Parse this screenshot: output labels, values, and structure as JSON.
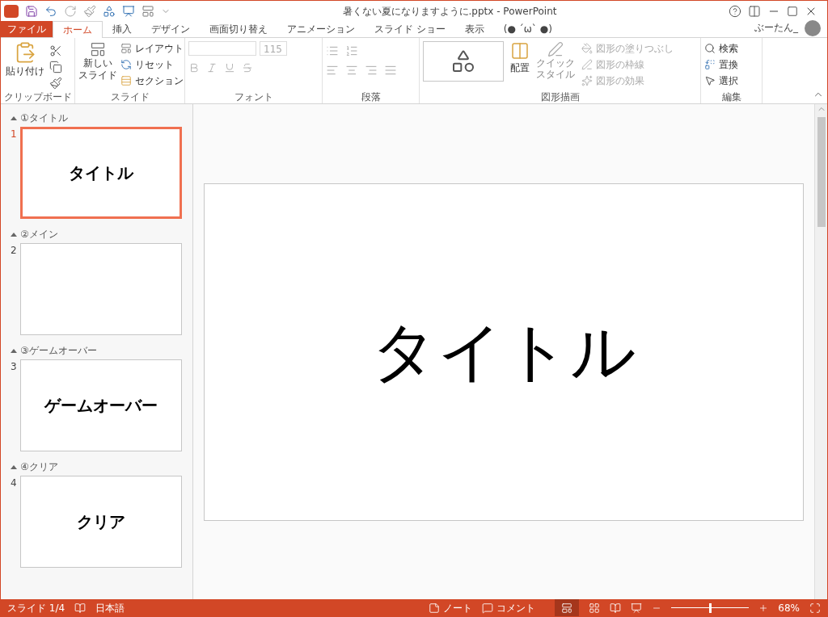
{
  "window": {
    "title": "暑くない夏になりますように.pptx - PowerPoint",
    "user": "ぶーたん_"
  },
  "tabs": [
    {
      "label": "ファイル",
      "kind": "file",
      "selected": false
    },
    {
      "label": "ホーム",
      "kind": "tab",
      "selected": true
    },
    {
      "label": "挿入",
      "kind": "tab",
      "selected": false
    },
    {
      "label": "デザイン",
      "kind": "tab",
      "selected": false
    },
    {
      "label": "画面切り替え",
      "kind": "tab",
      "selected": false
    },
    {
      "label": "アニメーション",
      "kind": "tab",
      "selected": false
    },
    {
      "label": "スライド ショー",
      "kind": "tab",
      "selected": false
    },
    {
      "label": "表示",
      "kind": "tab",
      "selected": false
    },
    {
      "label": "(● ´ω` ●)",
      "kind": "tab",
      "selected": false
    }
  ],
  "ribbon": {
    "clipboard": {
      "paste": "貼り付け",
      "label": "クリップボード"
    },
    "slides": {
      "new_slide": [
        "新しい",
        "スライド"
      ],
      "layout": "レイアウト",
      "reset": "リセット",
      "section": "セクション",
      "label": "スライド"
    },
    "font": {
      "size": "115",
      "label": "フォント"
    },
    "paragraph": {
      "label": "段落"
    },
    "drawing": {
      "arrange": "配置",
      "quick_style": [
        "クイック",
        "スタイル"
      ],
      "items": [
        {
          "label": "図形の塗りつぶし",
          "disabled": true
        },
        {
          "label": "図形の枠線",
          "disabled": true
        },
        {
          "label": "図形の効果",
          "disabled": true
        }
      ],
      "label": "図形描画"
    },
    "editing": {
      "find": "検索",
      "replace": "置換",
      "select": "選択",
      "label": "編集"
    }
  },
  "sections": [
    {
      "title": "①タイトル",
      "expanded": true,
      "slides": [
        {
          "number": "1",
          "text": "タイトル",
          "selected": true
        }
      ]
    },
    {
      "title": "②メイン",
      "expanded": true,
      "slides": [
        {
          "number": "2",
          "selected": false
        }
      ]
    },
    {
      "title": "③ゲームオーバー",
      "expanded": true,
      "slides": [
        {
          "number": "3",
          "text": "ゲームオーバー",
          "selected": false
        }
      ]
    },
    {
      "title": "④クリア",
      "expanded": true,
      "slides": [
        {
          "number": "4",
          "text": "クリア",
          "selected": false
        }
      ]
    }
  ],
  "slide": {
    "title": "タイトル"
  },
  "status_bar": {
    "slide": "スライド 1/4",
    "language": "日本語",
    "notes": "ノート",
    "comments": "コメント",
    "zoom": {
      "level": 0.5,
      "reading": "68%"
    }
  }
}
